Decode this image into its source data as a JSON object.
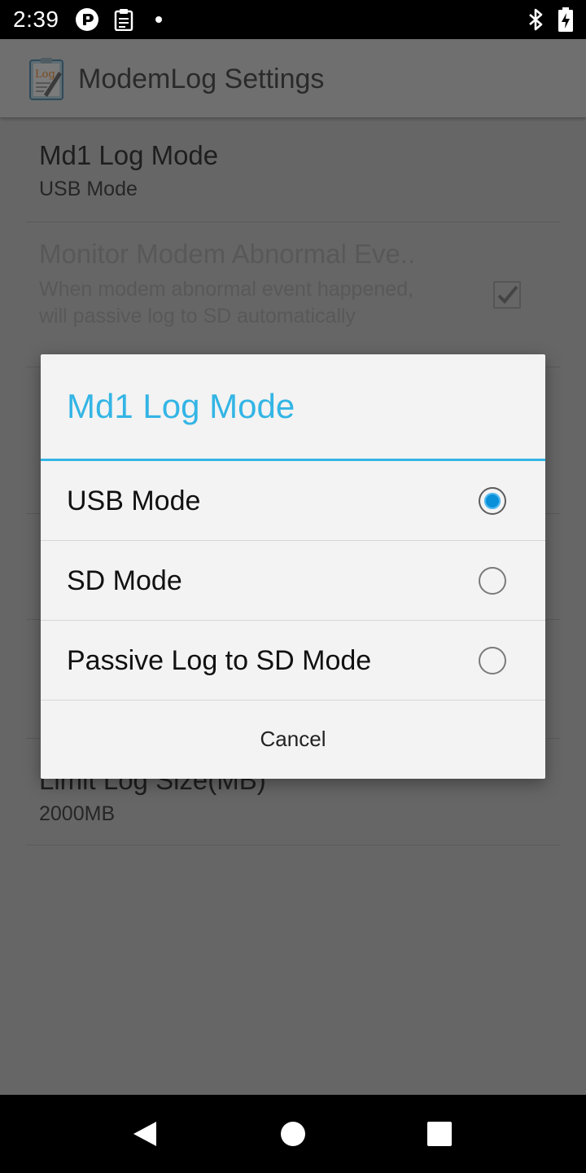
{
  "status_bar": {
    "time": "2:39",
    "icons": [
      "pocket-casts-icon",
      "clipboard-log-icon",
      "notification-dot-icon",
      "bluetooth-icon",
      "battery-charging-icon"
    ]
  },
  "app_bar": {
    "title": "ModemLog Settings",
    "icon": "log-app-icon"
  },
  "preferences": [
    {
      "title": "Md1 Log Mode",
      "summary": "USB Mode"
    },
    {
      "title": "Monitor Modem Abnormal Eve..",
      "summary": "When modem abnormal event happened, will passive log to SD automatically",
      "checked": true,
      "enabled": false
    },
    {
      "title": "Limit Log Size(MB)",
      "summary": "2000MB"
    }
  ],
  "dialog": {
    "title": "Md1 Log Mode",
    "options": [
      {
        "label": "USB Mode",
        "selected": true
      },
      {
        "label": "SD Mode",
        "selected": false
      },
      {
        "label": "Passive Log to SD Mode",
        "selected": false
      }
    ],
    "cancel_label": "Cancel"
  },
  "nav_bar": {
    "buttons": [
      "back-icon",
      "home-icon",
      "recents-icon"
    ]
  },
  "colors": {
    "accent": "#33b5e5",
    "radio_fill": "#0a8fd9",
    "scrim_background": "#666666"
  }
}
